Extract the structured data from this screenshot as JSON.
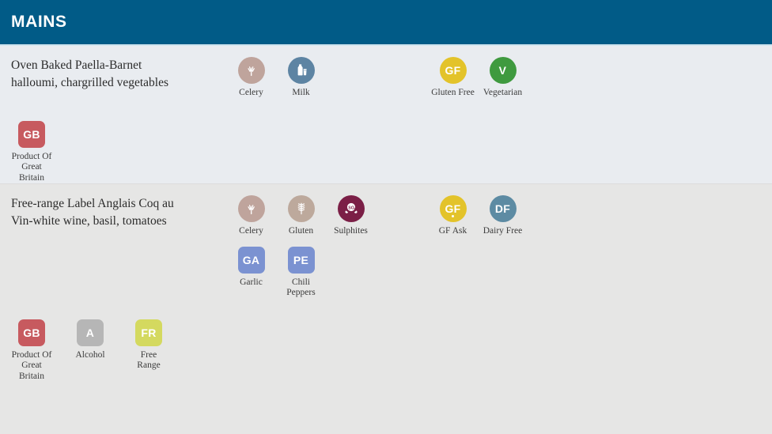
{
  "header": {
    "title": "MAINS",
    "bg_color": "#015b87",
    "underline_color": "#cfe4ee"
  },
  "colors": {
    "row_a_bg": "#e9ecf0",
    "row_b_bg": "#e6e6e5",
    "celery": "#bfa49c",
    "milk": "#5d84a3",
    "gluten": "#bda99c",
    "sulphites": "#7b1f46",
    "gluten_free": "#e3c32a",
    "vegetarian": "#3f9a3f",
    "dairy_free": "#5d8ba3",
    "garlic": "#7b92d1",
    "chili": "#7b92d1",
    "great_britain": "#c75a5f",
    "alcohol": "#b6b6b6",
    "free_range": "#d4d95f"
  },
  "dishes": [
    {
      "name": "dish-paella",
      "title_line1": "Oven Baked Paella-Barnet",
      "title_line2": "halloumi, chargrilled vegetables",
      "allergens": [
        {
          "icon": "celery-icon",
          "label": "Celery",
          "color": "#bfa49c",
          "shape": "circle",
          "art": "celery"
        },
        {
          "icon": "milk-icon",
          "label": "Milk",
          "color": "#5d84a3",
          "shape": "circle",
          "art": "milk"
        }
      ],
      "allergens_row2": [],
      "diets": [
        {
          "icon": "gluten-free-icon",
          "code": "GF",
          "label": "Gluten Free",
          "color": "#e3c32a",
          "shape": "circle"
        },
        {
          "icon": "vegetarian-icon",
          "code": "V",
          "label": "Vegetarian",
          "color": "#3f9a3f",
          "shape": "circle"
        }
      ],
      "diets_row2": [],
      "sources": [
        {
          "icon": "product-of-great-britain-icon",
          "code": "GB",
          "label": "Product Of Great Britain",
          "color": "#c75a5f",
          "shape": "rounded"
        }
      ]
    },
    {
      "name": "dish-coq-au-vin",
      "title_line1": "Free-range Label Anglais Coq au",
      "title_line2": "Vin-white wine, basil, tomatoes",
      "allergens": [
        {
          "icon": "celery-icon",
          "label": "Celery",
          "color": "#bfa49c",
          "shape": "circle",
          "art": "celery"
        },
        {
          "icon": "gluten-icon",
          "label": "Gluten",
          "color": "#bda99c",
          "shape": "circle",
          "art": "gluten"
        },
        {
          "icon": "sulphites-icon",
          "label": "Sulphites",
          "color": "#7b1f46",
          "shape": "circle",
          "art": "sulphites"
        }
      ],
      "allergens_row2": [
        {
          "icon": "garlic-icon",
          "code": "GA",
          "label": "Garlic",
          "color": "#7b92d1",
          "shape": "rounded"
        },
        {
          "icon": "chili-peppers-icon",
          "code": "PE",
          "label": "Chili Peppers",
          "color": "#7b92d1",
          "shape": "rounded"
        }
      ],
      "diets": [
        {
          "icon": "gluten-free-ask-icon",
          "code": "GF",
          "label": "GF Ask",
          "color": "#e3c32a",
          "shape": "circle",
          "dot": true
        },
        {
          "icon": "dairy-free-icon",
          "code": "DF",
          "label": "Dairy Free",
          "color": "#5d8ba3",
          "shape": "circle"
        }
      ],
      "diets_row2": [],
      "sources": [
        {
          "icon": "product-of-great-britain-icon",
          "code": "GB",
          "label": "Product Of Great Britain",
          "color": "#c75a5f",
          "shape": "rounded"
        },
        {
          "icon": "alcohol-icon",
          "code": "A",
          "label": "Alcohol",
          "color": "#b6b6b6",
          "shape": "rounded"
        },
        {
          "icon": "free-range-icon",
          "code": "FR",
          "label": "Free Range",
          "color": "#d4d95f",
          "shape": "rounded"
        }
      ]
    }
  ]
}
